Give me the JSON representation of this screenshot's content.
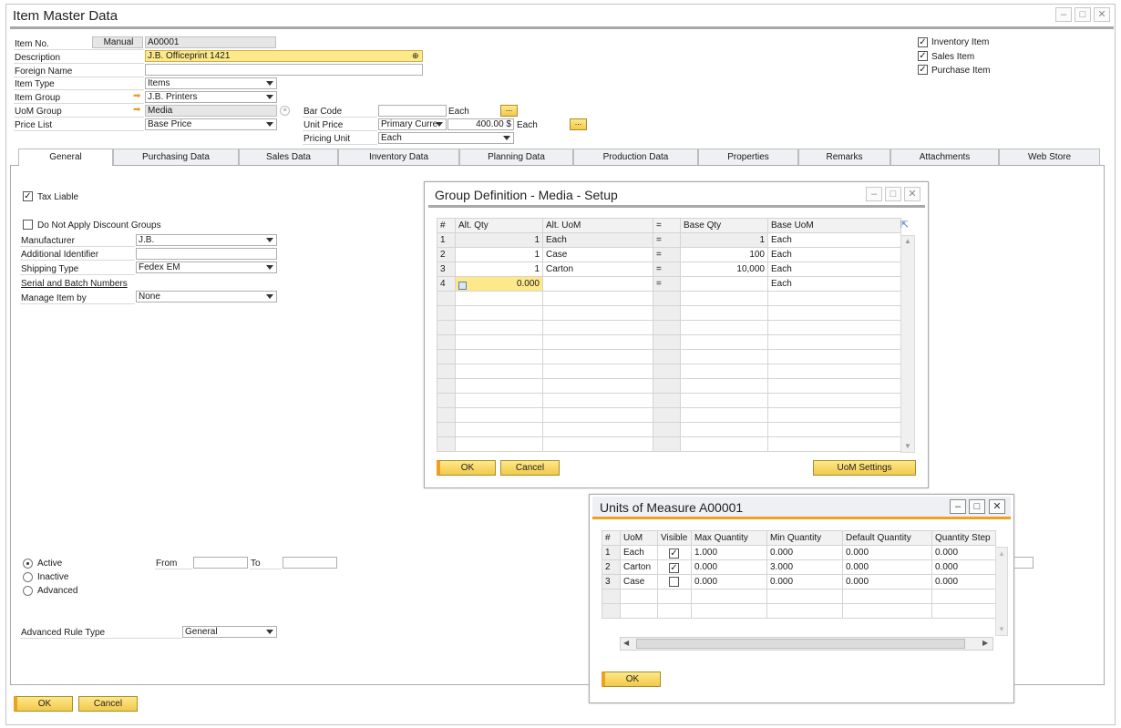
{
  "main_window": {
    "title": "Item Master Data",
    "header": {
      "item_no_label": "Item No.",
      "item_no_series": "Manual",
      "item_no_value": "A00001",
      "description_label": "Description",
      "description_value": "J.B. Officeprint 1421",
      "foreign_name_label": "Foreign Name",
      "item_type_label": "Item Type",
      "item_type_value": "Items",
      "item_group_label": "Item Group",
      "item_group_value": "J.B. Printers",
      "uom_group_label": "UoM Group",
      "uom_group_value": "Media",
      "price_list_label": "Price List",
      "price_list_value": "Base Price",
      "bar_code_label": "Bar Code",
      "bar_code_uom": "Each",
      "unit_price_label": "Unit Price",
      "unit_price_currency": "Primary Curre",
      "unit_price_value": "400.00 $",
      "unit_price_uom": "Each",
      "pricing_unit_label": "Pricing Unit",
      "pricing_unit_value": "Each",
      "ellipsis": "...",
      "inventory_item_label": "Inventory Item",
      "sales_item_label": "Sales Item",
      "purchase_item_label": "Purchase Item",
      "check_mark": "✓"
    },
    "tabs": [
      "General",
      "Purchasing Data",
      "Sales Data",
      "Inventory Data",
      "Planning Data",
      "Production Data",
      "Properties",
      "Remarks",
      "Attachments",
      "Web Store"
    ],
    "general": {
      "tax_liable_label": "Tax Liable",
      "no_discount_label": "Do Not Apply Discount Groups",
      "manufacturer_label": "Manufacturer",
      "manufacturer_value": "J.B.",
      "additional_identifier_label": "Additional Identifier",
      "shipping_type_label": "Shipping Type",
      "shipping_type_value": "Fedex EM",
      "serial_batch_label": "Serial and Batch Numbers",
      "manage_item_by_label": "Manage Item by",
      "manage_item_by_value": "None",
      "active_label": "Active",
      "inactive_label": "Inactive",
      "advanced_label": "Advanced",
      "from_label": "From",
      "to_label": "To",
      "advanced_rule_label": "Advanced Rule Type",
      "advanced_rule_value": "General"
    },
    "ok_label": "OK",
    "cancel_label": "Cancel"
  },
  "group_definition": {
    "title": "Group Definition - Media - Setup",
    "columns": [
      "#",
      "Alt. Qty",
      "Alt. UoM",
      "=",
      "Base Qty",
      "Base UoM"
    ],
    "rows": [
      {
        "n": "1",
        "alt_qty": "1",
        "alt_uom": "Each",
        "eq": "=",
        "base_qty": "1",
        "base_uom": "Each"
      },
      {
        "n": "2",
        "alt_qty": "1",
        "alt_uom": "Case",
        "eq": "=",
        "base_qty": "100",
        "base_uom": "Each"
      },
      {
        "n": "3",
        "alt_qty": "1",
        "alt_uom": "Carton",
        "eq": "=",
        "base_qty": "10,000",
        "base_uom": "Each"
      },
      {
        "n": "4",
        "alt_qty": "0.000",
        "alt_uom": "",
        "eq": "=",
        "base_qty": "",
        "base_uom": "Each"
      }
    ],
    "ok_label": "OK",
    "cancel_label": "Cancel",
    "uom_settings_label": "UoM Settings"
  },
  "units_of_measure": {
    "title": "Units of Measure A00001",
    "columns": [
      "#",
      "UoM",
      "Visible",
      "Max Quantity",
      "Min Quantity",
      "Default Quantity",
      "Quantity Step"
    ],
    "rows": [
      {
        "n": "1",
        "uom": "Each",
        "visible": true,
        "max": "1.000",
        "min": "0.000",
        "default": "0.000",
        "step": "0.000"
      },
      {
        "n": "2",
        "uom": "Carton",
        "visible": true,
        "max": "0.000",
        "min": "3.000",
        "default": "0.000",
        "step": "0.000"
      },
      {
        "n": "3",
        "uom": "Case",
        "visible": false,
        "max": "0.000",
        "min": "0.000",
        "default": "0.000",
        "step": "0.000"
      }
    ],
    "ok_label": "OK"
  },
  "icons": {
    "minimize": "minimize-icon",
    "maximize": "maximize-icon",
    "close": "close-icon"
  },
  "colors": {
    "button_yellow": "#f3c94a",
    "field_yellow": "#fde98a",
    "accent_orange": "#f0a020"
  }
}
